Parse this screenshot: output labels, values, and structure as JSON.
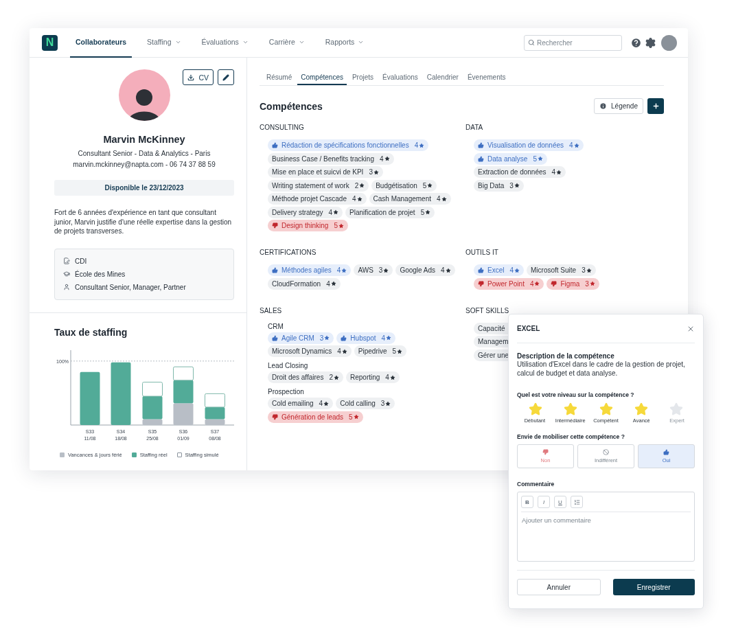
{
  "nav": {
    "logo": "N",
    "items": [
      {
        "label": "Collaborateurs",
        "selected": true,
        "dropdown": false
      },
      {
        "label": "Staffing",
        "selected": false,
        "dropdown": true
      },
      {
        "label": "Évaluations",
        "selected": false,
        "dropdown": true
      },
      {
        "label": "Carrière",
        "selected": false,
        "dropdown": true
      },
      {
        "label": "Rapports",
        "selected": false,
        "dropdown": true
      }
    ],
    "search": {
      "placeholder": "Rechercher"
    }
  },
  "profile": {
    "cv_button": "CV",
    "name": "Marvin McKinney",
    "subtitle": "Consultant Senior - Data & Analytics - Paris",
    "contact": "marvin.mckinney@napta.com - 06 74 37 88 59",
    "availability": "Disponible le 23/12/2023",
    "bio": "Fort de 6 années d'expérience en tant que consultant junior, Marvin justifie d'une réelle expertise dans la gestion de projets transverses.",
    "info": [
      {
        "kind": "contract",
        "text": "CDI"
      },
      {
        "kind": "school",
        "text": "École des Mines"
      },
      {
        "kind": "role",
        "text": "Consultant Senior, Manager, Partner"
      }
    ]
  },
  "staffing": {
    "title": "Taux de staffing",
    "chart_data": {
      "type": "bar",
      "stacked": true,
      "categories": [
        "S33 11/08",
        "S34 18/08",
        "S35 25/08",
        "S36 01/09",
        "S37 08/08"
      ],
      "ylim": [
        0,
        117
      ],
      "yticks": [
        {
          "value": 100,
          "label": "100%"
        }
      ],
      "series": [
        {
          "name": "Vancances & jours férié",
          "color": "#b8bec6",
          "values": [
            0,
            0,
            9,
            34,
            9
          ]
        },
        {
          "name": "Staffing réel",
          "color": "#52ab98",
          "values": [
            83,
            98,
            36,
            36,
            19
          ]
        },
        {
          "name": "Staffing simulé",
          "color": "#ffffff",
          "values": [
            0,
            0,
            22,
            21,
            21
          ]
        }
      ]
    }
  },
  "tabs": [
    {
      "label": "Résumé",
      "selected": false
    },
    {
      "label": "Compétences",
      "selected": true
    },
    {
      "label": "Projets",
      "selected": false
    },
    {
      "label": "Évaluations",
      "selected": false
    },
    {
      "label": "Calendrier",
      "selected": false
    },
    {
      "label": "Évenements",
      "selected": false
    }
  ],
  "skills": {
    "title": "Compétences",
    "legend_button": "Légende",
    "groups": [
      {
        "title": "CONSULTING",
        "skills": [
          {
            "name": "Rédaction de spécifications fonctionnelles",
            "rating": "4",
            "kind": "liked"
          },
          {
            "name": "Business Case / Benefits tracking",
            "rating": "4",
            "kind": "neutral"
          },
          {
            "name": "Mise en place et suicvi de KPI",
            "rating": "3",
            "kind": "neutral"
          },
          {
            "name": "Writing statement of work",
            "rating": "2",
            "kind": "neutral"
          },
          {
            "name": "Budgétisation",
            "rating": "5",
            "kind": "neutral"
          },
          {
            "name": "Méthode projet Cascade",
            "rating": "4",
            "kind": "neutral"
          },
          {
            "name": "Cash Management",
            "rating": "4",
            "kind": "neutral"
          },
          {
            "name": "Delivery strategy",
            "rating": "4",
            "kind": "neutral"
          },
          {
            "name": "Planification de projet",
            "rating": "5",
            "kind": "neutral"
          },
          {
            "name": "Design thinking",
            "rating": "5",
            "kind": "disliked"
          }
        ]
      },
      {
        "title": "DATA",
        "skills": [
          {
            "name": "Visualisation de données",
            "rating": "4",
            "kind": "liked"
          },
          {
            "name": "Data analyse",
            "rating": "5",
            "kind": "liked"
          },
          {
            "name": "Extraction de données",
            "rating": "4",
            "kind": "neutral"
          },
          {
            "name": "Big Data",
            "rating": "3",
            "kind": "neutral"
          }
        ]
      },
      {
        "title": "CERTIFICATIONS",
        "skills": [
          {
            "name": "Méthodes agiles",
            "rating": "4",
            "kind": "liked"
          },
          {
            "name": "AWS",
            "rating": "3",
            "kind": "neutral"
          },
          {
            "name": "Google Ads",
            "rating": "4",
            "kind": "neutral"
          },
          {
            "name": "CloudFormation",
            "rating": "4",
            "kind": "neutral"
          }
        ]
      },
      {
        "title": "OUTILS IT",
        "skills": [
          {
            "name": "Excel",
            "rating": "4",
            "kind": "liked"
          },
          {
            "name": "Microsoft Suite",
            "rating": "3",
            "kind": "neutral"
          },
          {
            "name": "Power Point",
            "rating": "4",
            "kind": "disliked"
          },
          {
            "name": "Figma",
            "rating": "3",
            "kind": "disliked"
          }
        ]
      },
      {
        "title": "SALES",
        "subgroups": [
          {
            "title": "CRM",
            "skills": [
              {
                "name": "Agile CRM",
                "rating": "3",
                "kind": "liked"
              },
              {
                "name": "Hubspot",
                "rating": "4",
                "kind": "liked"
              },
              {
                "name": "Microsoft Dynamics",
                "rating": "4",
                "kind": "neutral"
              },
              {
                "name": "Pipedrive",
                "rating": "5",
                "kind": "neutral"
              }
            ]
          },
          {
            "title": "Lead Closing",
            "skills": [
              {
                "name": "Droit des affaires",
                "rating": "2",
                "kind": "neutral"
              },
              {
                "name": "Reporting",
                "rating": "4",
                "kind": "neutral"
              }
            ]
          },
          {
            "title": "Prospection",
            "skills": [
              {
                "name": "Cold emailing",
                "rating": "4",
                "kind": "neutral"
              },
              {
                "name": "Cold calling",
                "rating": "3",
                "kind": "neutral"
              },
              {
                "name": "Génération de leads",
                "rating": "5",
                "kind": "disliked"
              }
            ]
          }
        ]
      },
      {
        "title": "SOFT SKILLS",
        "skills": [
          {
            "name": "Capacité",
            "kind": "neutral"
          },
          {
            "name": "Managem",
            "kind": "neutral"
          },
          {
            "name": "Gérer une",
            "kind": "neutral"
          }
        ]
      }
    ]
  },
  "dialog": {
    "title": "EXCEL",
    "description_title": "Description de la compétence",
    "description": "Utilisation d'Excel dans le cadre de la gestion de projet, calcul de budget et data analyse.",
    "level_question": "Quel est votre niveau sur la compétence ?",
    "levels": [
      "Débutant",
      "Intermédiaire",
      "Compétent",
      "Avancé",
      "Expert"
    ],
    "stars": 4,
    "mobilize_question": "Envie de mobiliser cette compétence ?",
    "mobilize_options": [
      {
        "kind": "no",
        "label": "Non",
        "selected": false
      },
      {
        "kind": "neutral",
        "label": "Indifférent",
        "selected": false
      },
      {
        "kind": "yes",
        "label": "Oui",
        "selected": true
      }
    ],
    "comment_label": "Commentaire",
    "format_buttons": [
      "B",
      "I",
      "U"
    ],
    "comment_placeholder": "Ajouter un commentaire",
    "cancel": "Annuler",
    "save": "Enregistrer"
  }
}
